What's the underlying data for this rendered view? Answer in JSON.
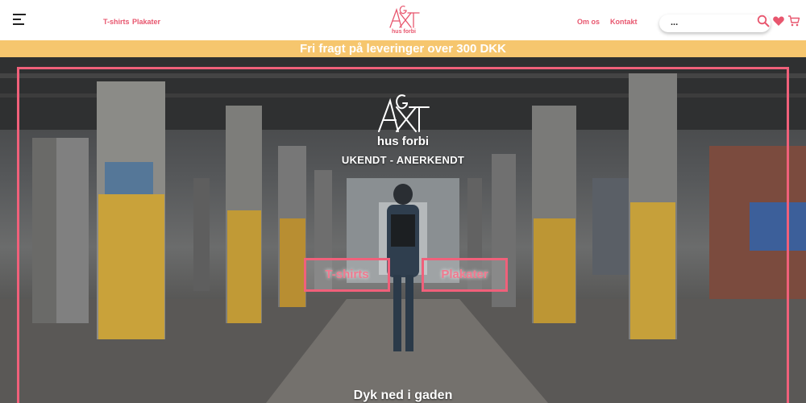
{
  "header": {
    "nav_left": [
      "T-shirts",
      "Plakater"
    ],
    "nav_right": [
      "Om os",
      "Kontakt"
    ],
    "logo_text": "hus forbi",
    "search_value": "...",
    "icons": [
      "menu-icon",
      "search-icon",
      "heart-icon",
      "cart-icon"
    ]
  },
  "banner": {
    "text": "Fri fragt på leveringer over 300 DKK"
  },
  "hero": {
    "brand": "hus forbi",
    "tagline": "UKENDT - ANERKENDT",
    "buttons": [
      "T-shirts",
      "Plakater"
    ],
    "bottom_text": "Dyk ned i gaden"
  },
  "colors": {
    "accent": "#f0607a",
    "nav_text": "#e8566e",
    "banner_bg": "#f6c66e",
    "header_bg": "#ffffff"
  }
}
